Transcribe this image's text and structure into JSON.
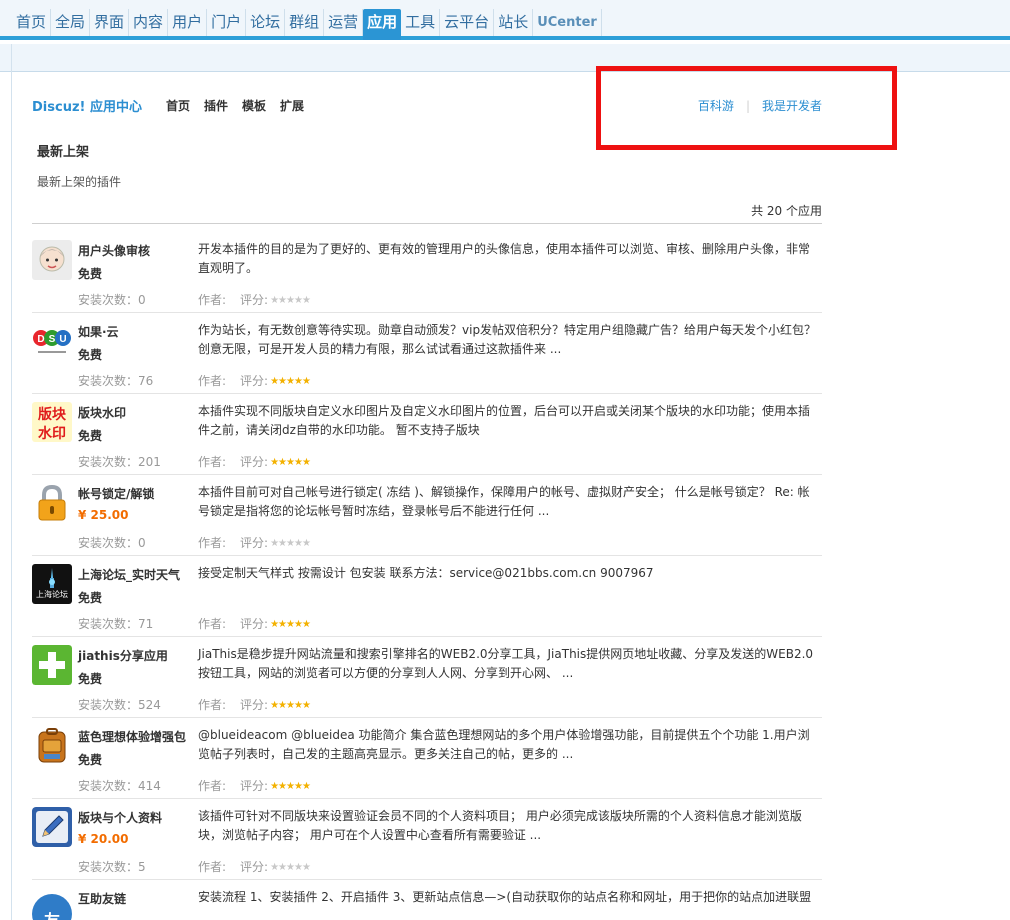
{
  "topnav": {
    "tabs": [
      "首页",
      "全局",
      "界面",
      "内容",
      "用户",
      "门户",
      "论坛",
      "群组",
      "运营",
      "应用",
      "工具",
      "云平台",
      "站长",
      "UCenter"
    ],
    "active_tab": "应用"
  },
  "appcenter": {
    "brand": "Discuz! 应用中心",
    "nav": [
      "首页",
      "插件",
      "模板",
      "扩展"
    ],
    "right_links": [
      "百科游",
      "我是开发者"
    ]
  },
  "section": {
    "title": "最新上架",
    "desc": "最新上架的插件",
    "count": "共 20 个应用"
  },
  "labels": {
    "author": "作者:",
    "rating": "评分:"
  },
  "colors": {
    "accent": "#2d9fd8",
    "link": "#2b8ed1",
    "price": "#f26c00",
    "highlight_box": "#ee1111"
  },
  "items": [
    {
      "name": "用户头像审核",
      "price": "免费",
      "installs": "安装次数：0",
      "desc": "开发本插件的目的是为了更好的、更有效的管理用户的头像信息，使用本插件可以浏览、审核、删除用户头像，非常直观明了。",
      "rating": 0,
      "icon": "avatar-face-icon"
    },
    {
      "name": "如果·云",
      "price": "免费",
      "installs": "安装次数：76",
      "desc": "作为站长，有无数创意等待实现。勋章自动颁发？vip发帖双倍积分？特定用户组隐藏广告？给用户每天发个小红包？创意无限，可是开发人员的精力有限，那么试试看通过这款插件来 ...",
      "rating": 5,
      "icon": "dsu-logo-icon",
      "icon_text": "DSU"
    },
    {
      "name": "版块水印",
      "price": "免费",
      "installs": "安装次数：201",
      "desc": "本插件实现不同版块自定义水印图片及自定义水印图片的位置，后台可以开启或关闭某个版块的水印功能；使用本插件之前，请关闭dz自带的水印功能。 暂不支持子版块",
      "rating": 5,
      "icon": "watermark-text-icon",
      "icon_text": "版块水印"
    },
    {
      "name": "帐号锁定/解锁",
      "price": "¥ 25.00",
      "installs": "安装次数：0",
      "desc": "本插件目前可对自己帐号进行锁定( 冻结 )、解锁操作，保障用户的帐号、虚拟财产安全； 什么是帐号锁定？ Re: 帐号锁定是指将您的论坛帐号暂时冻结，登录帐号后不能进行任何 ...",
      "rating": 0,
      "icon": "padlock-icon"
    },
    {
      "name": "上海论坛_实时天气",
      "price": "免费",
      "installs": "安装次数：71",
      "desc": "接受定制天气样式 按需设计 包安装 联系方法：service@021bbs.com.cn 9007967",
      "rating": 5,
      "icon": "shanghai-forum-logo-icon",
      "icon_text": "上海论坛"
    },
    {
      "name": "jiathis分享应用",
      "price": "免费",
      "installs": "安装次数：524",
      "desc": "JiaThis是稳步提升网站流量和搜索引擎排名的WEB2.0分享工具，JiaThis提供网页地址收藏、分享及发送的WEB2.0按钮工具，网站的浏览者可以方便的分享到人人网、分享到开心网、 ...",
      "rating": 5,
      "icon": "green-plus-icon"
    },
    {
      "name": "蓝色理想体验增强包",
      "price": "免费",
      "installs": "安装次数：414",
      "desc": "@blueideacom @blueidea 功能简介 集合蓝色理想网站的多个用户体验增强功能，目前提供五个个功能 1.用户浏览帖子列表时，自己发的主题高亮显示。更多关注自己的帖，更多的 ...",
      "rating": 5,
      "icon": "backpack-icon"
    },
    {
      "name": "版块与个人资料",
      "price": "¥ 20.00",
      "installs": "安装次数：5",
      "desc": "该插件可针对不同版块来设置验证会员不同的个人资料项目； 用户必须完成该版块所需的个人资料信息才能浏览版块，浏览帖子内容； 用户可在个人设置中心查看所有需要验证 ...",
      "rating": 0,
      "icon": "edit-pencil-icon"
    },
    {
      "name": "互助友链",
      "price": "",
      "installs": "",
      "desc": "安装流程 1、安装插件 2、开启插件 3、更新站点信息—>(自动获取你的站点名称和网址，用于把你的站点加进联盟",
      "rating": 0,
      "icon": "friend-link-icon",
      "icon_text": "友"
    }
  ]
}
